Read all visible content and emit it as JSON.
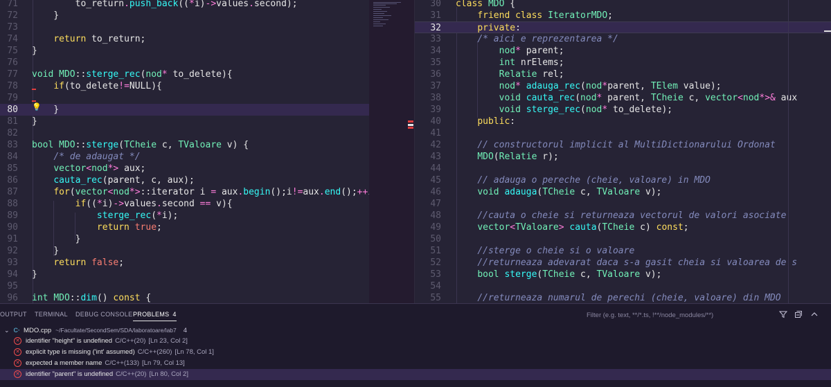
{
  "left_editor": {
    "lines": [
      {
        "n": "71",
        "code": "        to_return.push_back((*i)->values.second);"
      },
      {
        "n": "72",
        "code": "    }"
      },
      {
        "n": "73",
        "code": ""
      },
      {
        "n": "74",
        "code": "    return to_return;"
      },
      {
        "n": "75",
        "code": "}"
      },
      {
        "n": "76",
        "code": ""
      },
      {
        "n": "77",
        "code": "void MDO::sterge_rec(nod* to_delete){"
      },
      {
        "n": "78",
        "code": "    if(to_delete!=NULL){"
      },
      {
        "n": "79",
        "code": ""
      },
      {
        "n": "80",
        "code": "    }"
      },
      {
        "n": "81",
        "code": "}"
      },
      {
        "n": "82",
        "code": ""
      },
      {
        "n": "83",
        "code": "bool MDO::sterge(TCheie c, TValoare v) {"
      },
      {
        "n": "84",
        "code": "    /* de adaugat */"
      },
      {
        "n": "85",
        "code": "    vector<nod*> aux;"
      },
      {
        "n": "86",
        "code": "    cauta_rec(parent, c, aux);"
      },
      {
        "n": "87",
        "code": "    for(vector<nod*>::iterator i = aux.begin();i!=aux.end();++i)"
      },
      {
        "n": "88",
        "code": "        if((*i)->values.second == v){"
      },
      {
        "n": "89",
        "code": "            sterge_rec(*i);"
      },
      {
        "n": "90",
        "code": "            return true;"
      },
      {
        "n": "91",
        "code": "        }"
      },
      {
        "n": "92",
        "code": "    }"
      },
      {
        "n": "93",
        "code": "    return false;"
      },
      {
        "n": "94",
        "code": "}"
      },
      {
        "n": "95",
        "code": ""
      },
      {
        "n": "96",
        "code": "int MDO::dim() const {"
      }
    ]
  },
  "right_editor": {
    "lines": [
      {
        "n": "30",
        "code": "class MDO {"
      },
      {
        "n": "31",
        "code": "    friend class IteratorMDO;"
      },
      {
        "n": "32",
        "code": "    private:"
      },
      {
        "n": "33",
        "code": "    /* aici e reprezentarea */"
      },
      {
        "n": "34",
        "code": "        nod* parent;"
      },
      {
        "n": "35",
        "code": "        int nrElems;"
      },
      {
        "n": "36",
        "code": "        Relatie rel;"
      },
      {
        "n": "37",
        "code": "        nod* adauga_rec(nod*parent, TElem value);"
      },
      {
        "n": "38",
        "code": "        void cauta_rec(nod* parent, TCheie c, vector<nod*>& aux"
      },
      {
        "n": "39",
        "code": "        void sterge_rec(nod* to_delete);"
      },
      {
        "n": "40",
        "code": "    public:"
      },
      {
        "n": "41",
        "code": ""
      },
      {
        "n": "42",
        "code": "    // constructorul implicit al MultiDictionarului Ordonat"
      },
      {
        "n": "43",
        "code": "    MDO(Relatie r);"
      },
      {
        "n": "44",
        "code": ""
      },
      {
        "n": "45",
        "code": "    // adauga o pereche (cheie, valoare) in MDO"
      },
      {
        "n": "46",
        "code": "    void adauga(TCheie c, TValoare v);"
      },
      {
        "n": "47",
        "code": ""
      },
      {
        "n": "48",
        "code": "    //cauta o cheie si returneaza vectorul de valori asociate"
      },
      {
        "n": "49",
        "code": "    vector<TValoare> cauta(TCheie c) const;"
      },
      {
        "n": "50",
        "code": ""
      },
      {
        "n": "51",
        "code": "    //sterge o cheie si o valoare"
      },
      {
        "n": "52",
        "code": "    //returneaza adevarat daca s-a gasit cheia si valoarea de s"
      },
      {
        "n": "53",
        "code": "    bool sterge(TCheie c, TValoare v);"
      },
      {
        "n": "54",
        "code": ""
      },
      {
        "n": "55",
        "code": "    //returneaza numarul de perechi (cheie, valoare) din MDO"
      }
    ]
  },
  "panel": {
    "tabs": {
      "output": "OUTPUT",
      "terminal": "TERMINAL",
      "debug": "DEBUG CONSOLE",
      "problems": "PROBLEMS",
      "problems_count": "4"
    },
    "filter_placeholder": "Filter (e.g. text, **/*.ts, !**/node_modules/**)",
    "file": {
      "name": "MDO.cpp",
      "path": "~/Facultate/SecondSem/SDA/laboratoare/lab7",
      "count": "4"
    },
    "problems": [
      {
        "msg": "identifier \"height\" is undefined",
        "src": "C/C++(20)",
        "loc": "[Ln 23, Col 2]"
      },
      {
        "msg": "explicit type is missing ('int' assumed)",
        "src": "C/C++(260)",
        "loc": "[Ln 78, Col 1]"
      },
      {
        "msg": "expected a member name",
        "src": "C/C++(133)",
        "loc": "[Ln 79, Col 13]"
      },
      {
        "msg": "identifier \"parent\" is undefined",
        "src": "C/C++(20)",
        "loc": "[Ln 80, Col 2]"
      }
    ]
  },
  "icons": [
    "lightbulb-icon",
    "filter-icon",
    "collapse-all-icon",
    "chevron-down-icon",
    "error-icon",
    "cpp-file-icon"
  ]
}
